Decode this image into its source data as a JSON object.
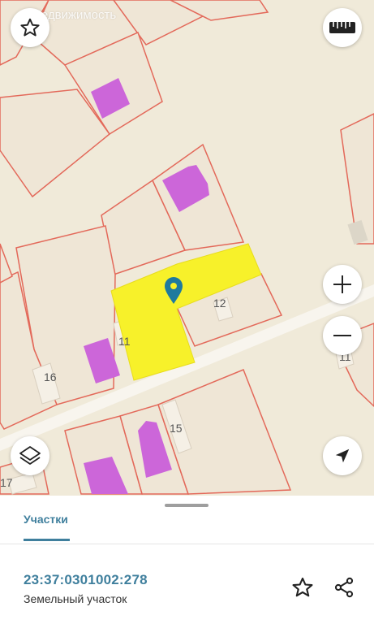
{
  "watermark": {
    "text": "Недвижимость"
  },
  "map": {
    "house_numbers": [
      "12",
      "11",
      "15",
      "16",
      "17",
      "11"
    ],
    "colors": {
      "background": "#f0ead9",
      "parcel_border": "#e3695a",
      "building": "#cc66d9",
      "selected": "#f7f12a",
      "pin": "#1f7a9e"
    },
    "icons": [
      "star-icon",
      "ruler-icon",
      "plus-icon",
      "minus-icon",
      "layers-icon",
      "locate-arrow-icon"
    ]
  },
  "sheet": {
    "tab_label": "Участки",
    "cadastral_number": "23:37:0301002:278",
    "object_type": "Земельный участок",
    "icons": [
      "star-icon",
      "share-icon"
    ],
    "accent_color": "#3f7f9d"
  }
}
